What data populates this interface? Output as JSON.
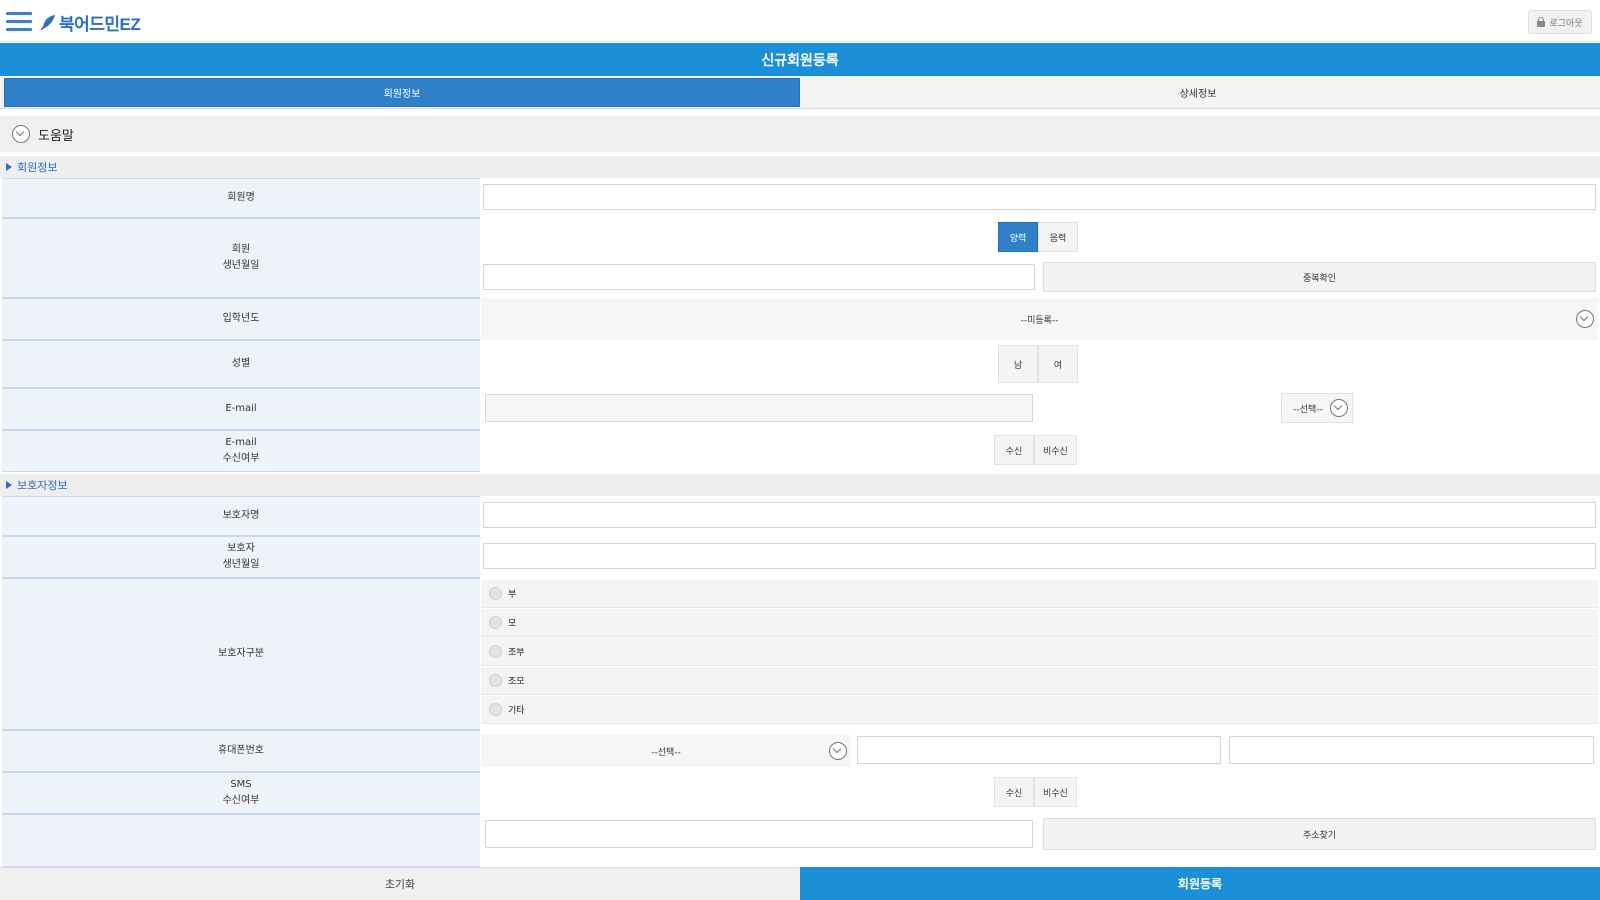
{
  "header": {
    "brand": "북어드민EZ",
    "logout_label": "로그아웃"
  },
  "title": "신규회원등록",
  "tabs": [
    {
      "label": "회원정보",
      "active": true
    },
    {
      "label": "상세정보",
      "active": false
    }
  ],
  "help_label": "도움말",
  "sections": {
    "member": "회원정보",
    "guardian": "보호자정보"
  },
  "form": {
    "name_label": "회원명",
    "birth_label_1": "회원",
    "birth_label_2": "생년월일",
    "calendar_options": [
      "양력",
      "음력"
    ],
    "duplicate_check": "중복확인",
    "entry_label": "입학년도",
    "entry_select": "--미등록--",
    "gender_label": "성별",
    "gender_options": [
      "남",
      "여"
    ],
    "email_label": "E-mail",
    "email_domain_select": "--선택--",
    "email_consent_label_1": "E-mail",
    "email_consent_label_2": "수신여부",
    "consent_options": [
      "수신",
      "비수신"
    ],
    "guardian_name_label": "보호자명",
    "guardian_birth_label_1": "보호자",
    "guardian_birth_label_2": "생년월일",
    "guardian_type_label": "보호자구분",
    "guardian_types": [
      "부",
      "모",
      "조부",
      "조모",
      "기타"
    ],
    "phone_label": "휴대폰번호",
    "phone_select": "--선택--",
    "sms_label_1": "SMS",
    "sms_label_2": "수신여부",
    "sms_options": [
      "수신",
      "비수신"
    ],
    "address_search": "주소찾기"
  },
  "footer": {
    "reset": "초기화",
    "submit": "회원등록"
  },
  "colors": {
    "primary": "#1c8fd9",
    "active_tab": "#2f80c9",
    "label_bg": "#edf3f9"
  }
}
